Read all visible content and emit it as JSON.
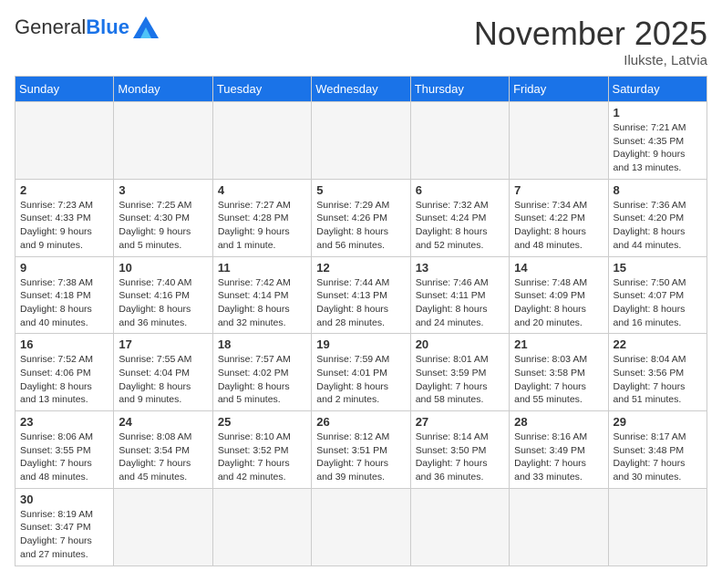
{
  "logo": {
    "text_general": "General",
    "text_blue": "Blue"
  },
  "title": "November 2025",
  "location": "Ilukste, Latvia",
  "weekdays": [
    "Sunday",
    "Monday",
    "Tuesday",
    "Wednesday",
    "Thursday",
    "Friday",
    "Saturday"
  ],
  "days": [
    {
      "date": 1,
      "sunrise": "7:21 AM",
      "sunset": "4:35 PM",
      "daylight": "9 hours and 13 minutes"
    },
    {
      "date": 2,
      "sunrise": "7:23 AM",
      "sunset": "4:33 PM",
      "daylight": "9 hours and 9 minutes"
    },
    {
      "date": 3,
      "sunrise": "7:25 AM",
      "sunset": "4:30 PM",
      "daylight": "9 hours and 5 minutes"
    },
    {
      "date": 4,
      "sunrise": "7:27 AM",
      "sunset": "4:28 PM",
      "daylight": "9 hours and 1 minute"
    },
    {
      "date": 5,
      "sunrise": "7:29 AM",
      "sunset": "4:26 PM",
      "daylight": "8 hours and 56 minutes"
    },
    {
      "date": 6,
      "sunrise": "7:32 AM",
      "sunset": "4:24 PM",
      "daylight": "8 hours and 52 minutes"
    },
    {
      "date": 7,
      "sunrise": "7:34 AM",
      "sunset": "4:22 PM",
      "daylight": "8 hours and 48 minutes"
    },
    {
      "date": 8,
      "sunrise": "7:36 AM",
      "sunset": "4:20 PM",
      "daylight": "8 hours and 44 minutes"
    },
    {
      "date": 9,
      "sunrise": "7:38 AM",
      "sunset": "4:18 PM",
      "daylight": "8 hours and 40 minutes"
    },
    {
      "date": 10,
      "sunrise": "7:40 AM",
      "sunset": "4:16 PM",
      "daylight": "8 hours and 36 minutes"
    },
    {
      "date": 11,
      "sunrise": "7:42 AM",
      "sunset": "4:14 PM",
      "daylight": "8 hours and 32 minutes"
    },
    {
      "date": 12,
      "sunrise": "7:44 AM",
      "sunset": "4:13 PM",
      "daylight": "8 hours and 28 minutes"
    },
    {
      "date": 13,
      "sunrise": "7:46 AM",
      "sunset": "4:11 PM",
      "daylight": "8 hours and 24 minutes"
    },
    {
      "date": 14,
      "sunrise": "7:48 AM",
      "sunset": "4:09 PM",
      "daylight": "8 hours and 20 minutes"
    },
    {
      "date": 15,
      "sunrise": "7:50 AM",
      "sunset": "4:07 PM",
      "daylight": "8 hours and 16 minutes"
    },
    {
      "date": 16,
      "sunrise": "7:52 AM",
      "sunset": "4:06 PM",
      "daylight": "8 hours and 13 minutes"
    },
    {
      "date": 17,
      "sunrise": "7:55 AM",
      "sunset": "4:04 PM",
      "daylight": "8 hours and 9 minutes"
    },
    {
      "date": 18,
      "sunrise": "7:57 AM",
      "sunset": "4:02 PM",
      "daylight": "8 hours and 5 minutes"
    },
    {
      "date": 19,
      "sunrise": "7:59 AM",
      "sunset": "4:01 PM",
      "daylight": "8 hours and 2 minutes"
    },
    {
      "date": 20,
      "sunrise": "8:01 AM",
      "sunset": "3:59 PM",
      "daylight": "7 hours and 58 minutes"
    },
    {
      "date": 21,
      "sunrise": "8:03 AM",
      "sunset": "3:58 PM",
      "daylight": "7 hours and 55 minutes"
    },
    {
      "date": 22,
      "sunrise": "8:04 AM",
      "sunset": "3:56 PM",
      "daylight": "7 hours and 51 minutes"
    },
    {
      "date": 23,
      "sunrise": "8:06 AM",
      "sunset": "3:55 PM",
      "daylight": "7 hours and 48 minutes"
    },
    {
      "date": 24,
      "sunrise": "8:08 AM",
      "sunset": "3:54 PM",
      "daylight": "7 hours and 45 minutes"
    },
    {
      "date": 25,
      "sunrise": "8:10 AM",
      "sunset": "3:52 PM",
      "daylight": "7 hours and 42 minutes"
    },
    {
      "date": 26,
      "sunrise": "8:12 AM",
      "sunset": "3:51 PM",
      "daylight": "7 hours and 39 minutes"
    },
    {
      "date": 27,
      "sunrise": "8:14 AM",
      "sunset": "3:50 PM",
      "daylight": "7 hours and 36 minutes"
    },
    {
      "date": 28,
      "sunrise": "8:16 AM",
      "sunset": "3:49 PM",
      "daylight": "7 hours and 33 minutes"
    },
    {
      "date": 29,
      "sunrise": "8:17 AM",
      "sunset": "3:48 PM",
      "daylight": "7 hours and 30 minutes"
    },
    {
      "date": 30,
      "sunrise": "8:19 AM",
      "sunset": "3:47 PM",
      "daylight": "7 hours and 27 minutes"
    }
  ]
}
